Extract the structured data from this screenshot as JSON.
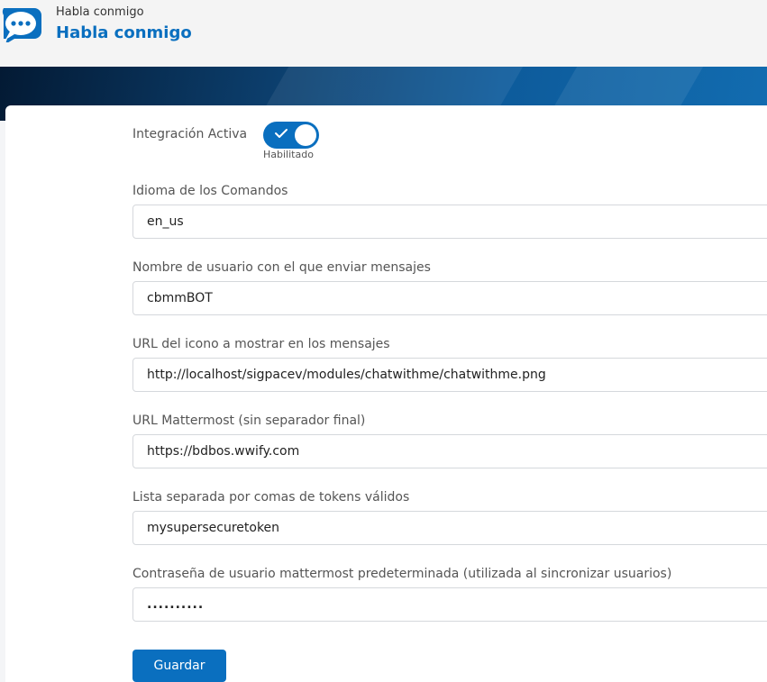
{
  "header": {
    "breadcrumb": "Habla conmigo",
    "title": "Habla conmigo",
    "icon": "chat-bubble-icon"
  },
  "form": {
    "active": {
      "label": "Integración Activa",
      "state": "Habilitado",
      "enabled": true
    },
    "language": {
      "label": "Idioma de los Comandos",
      "value": "en_us"
    },
    "username": {
      "label": "Nombre de usuario con el que enviar mensajes",
      "value": "cbmmBOT"
    },
    "icon_url": {
      "label": "URL del icono a mostrar en los mensajes",
      "value": "http://localhost/sigpacev/modules/chatwithme/chatwithme.png"
    },
    "mattermost_url": {
      "label": "URL Mattermost (sin separador final)",
      "value": "https://bdbos.wwify.com"
    },
    "tokens": {
      "label": "Lista separada por comas de tokens válidos",
      "value": "mysupersecuretoken"
    },
    "password": {
      "label": "Contraseña de usuario mattermost predeterminada (utilizada al sincronizar usuarios)",
      "value": ".........."
    },
    "save_label": "Guardar"
  },
  "colors": {
    "accent": "#0a6fbf",
    "banner_dark": "#031a34"
  }
}
